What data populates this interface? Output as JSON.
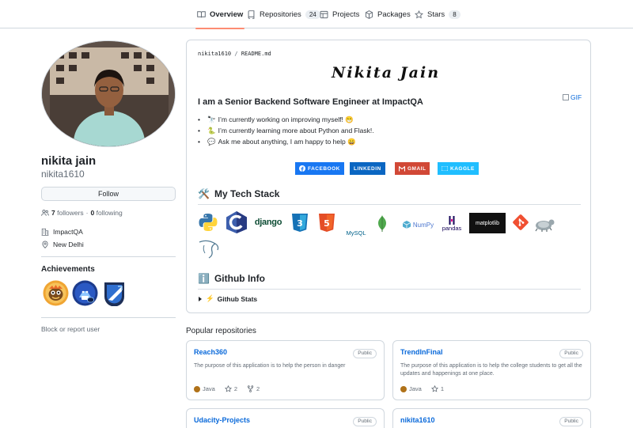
{
  "tabs": [
    {
      "label": "Overview",
      "icon": "book-icon"
    },
    {
      "label": "Repositories",
      "count": "24",
      "icon": "repo-icon"
    },
    {
      "label": "Projects",
      "icon": "table-icon"
    },
    {
      "label": "Packages",
      "icon": "package-icon"
    },
    {
      "label": "Stars",
      "count": "8",
      "icon": "star-icon"
    }
  ],
  "profile": {
    "name": "nikita jain",
    "login": "nikita1610",
    "follow_label": "Follow",
    "followers_count": "7",
    "followers_label": "followers",
    "following_count": "0",
    "following_label": "following",
    "dot": "·",
    "company": "ImpactQA",
    "location": "New Delhi",
    "achievements_title": "Achievements",
    "block_label": "Block or report user"
  },
  "readme": {
    "path_user": "nikita1610",
    "path_sep": "/",
    "path_file": "README.md",
    "signature": "Nikita Jain",
    "gif_alt": "GIF",
    "headline": "I am a Senior Backend Software Engineer at ImpactQA",
    "bullets": [
      {
        "emoji": "🔭",
        "text": "I’m currently working on improving myself! 😁"
      },
      {
        "emoji": "🐍",
        "text": "I’m currently learning more about Python and Flask!."
      },
      {
        "emoji": "💬",
        "text": "Ask me about anything, I am happy to help 😄"
      }
    ],
    "shields": [
      {
        "label": "FACEBOOK",
        "color": "#1877f2"
      },
      {
        "label": "LINKEDIN",
        "color": "#0a66c2"
      },
      {
        "label": "GMAIL",
        "color": "#d14836"
      },
      {
        "label": "KAGGLE",
        "color": "#20beff"
      }
    ],
    "tech_title": "My Tech Stack",
    "tech_emoji": "🛠️",
    "tech_labels": {
      "django": "django",
      "mysql": "MySQL",
      "numpy": "NumPy",
      "pandas": "pandas",
      "matplotlib": "matplotlib"
    },
    "github_info_title": "Github Info",
    "info_emoji": "ℹ️",
    "github_stats_label": "Github Stats",
    "stats_emoji": "⚡"
  },
  "popular_title": "Popular repositories",
  "repos": [
    {
      "name": "Reach360",
      "visibility": "Public",
      "desc": "The purpose of this application is to help the person in danger",
      "language": "Java",
      "stars": "2",
      "forks": "2"
    },
    {
      "name": "TrendInFinal",
      "visibility": "Public",
      "desc": "The purpose of this application is to help the college students to get all the updates and happenings at one place.",
      "language": "Java",
      "stars": "1"
    },
    {
      "name": "Udacity-Projects",
      "visibility": "Public"
    },
    {
      "name": "nikita1610",
      "visibility": "Public"
    }
  ],
  "colors": {
    "accent": "#fd8c73",
    "link": "#0969da",
    "java": "#b07219",
    "border": "#d0d7de"
  }
}
